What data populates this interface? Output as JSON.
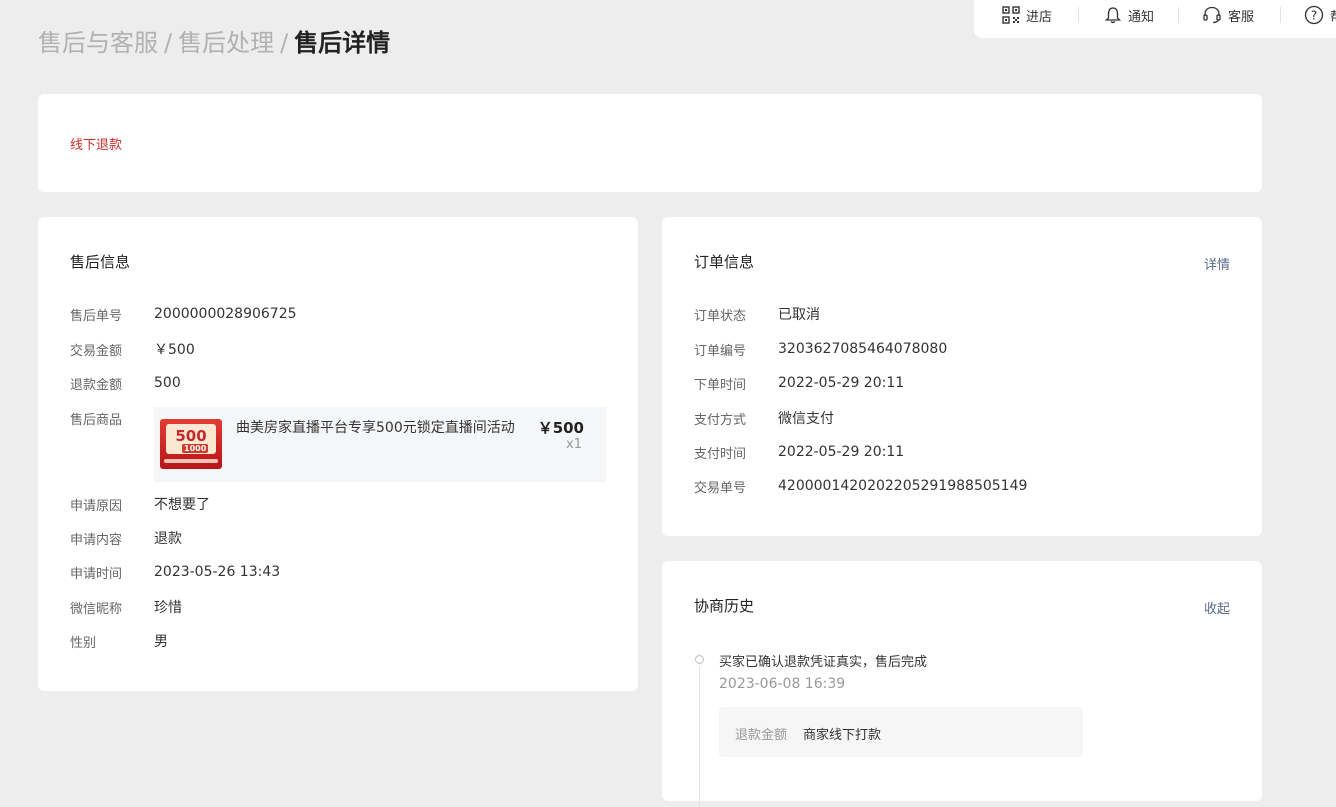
{
  "topbar": {
    "items": [
      {
        "label": "进店",
        "icon": "qrcode-icon"
      },
      {
        "label": "通知",
        "icon": "bell-icon"
      },
      {
        "label": "客服",
        "icon": "headset-icon"
      },
      {
        "label": "帮",
        "icon": "help-icon"
      }
    ]
  },
  "breadcrumb": {
    "level1": "售后与客服",
    "level2": "售后处理",
    "current": "售后详情",
    "separator": "/"
  },
  "status": {
    "text": "线下退款",
    "color": "#c9302c"
  },
  "after_sale": {
    "title": "售后信息",
    "fields": [
      {
        "label": "售后单号",
        "value": "2000000028906725"
      },
      {
        "label": "交易金额",
        "value": "￥500"
      },
      {
        "label": "退款金额",
        "value": "500"
      },
      {
        "label": "售后商品",
        "value": ""
      },
      {
        "label": "申请原因",
        "value": "不想要了"
      },
      {
        "label": "申请内容",
        "value": "退款"
      },
      {
        "label": "申请时间",
        "value": "2023-05-26 13:43"
      },
      {
        "label": "微信昵称",
        "value": "珍惜"
      },
      {
        "label": "性别",
        "value": "男"
      }
    ],
    "product": {
      "name": "曲美房家直播平台专享500元锁定直播间活动",
      "price": "￥500",
      "qty": "x1",
      "thumb_big": "500",
      "thumb_small": "1000"
    }
  },
  "order": {
    "title": "订单信息",
    "link": "详情",
    "fields": [
      {
        "label": "订单状态",
        "value": "已取消"
      },
      {
        "label": "订单编号",
        "value": "3203627085464078080"
      },
      {
        "label": "下单时间",
        "value": "2022-05-29 20:11"
      },
      {
        "label": "支付方式",
        "value": "微信支付"
      },
      {
        "label": "支付时间",
        "value": "2022-05-29 20:11"
      },
      {
        "label": "交易单号",
        "value": "4200001420202205291988505149"
      }
    ]
  },
  "history": {
    "title": "协商历史",
    "link": "收起",
    "events": [
      {
        "text": "买家已确认退款凭证真实，售后完成",
        "time": "2023-06-08 16:39",
        "detail_label": "退款金额",
        "detail_value": "商家线下打款"
      }
    ]
  }
}
